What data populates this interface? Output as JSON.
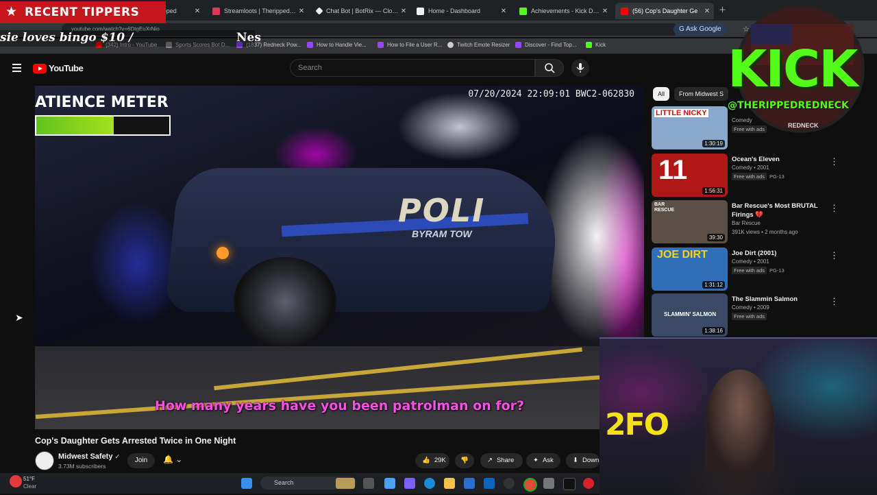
{
  "browser": {
    "tabs": [
      {
        "title": "Streamloots | Therippedred",
        "color": "#e3384f",
        "partial_title": "treamloots | Theripped"
      },
      {
        "title": "Streamloots | Therippedredn",
        "color": "#e3384f"
      },
      {
        "title": "Chat Bot | BotRix — Cloud S",
        "color": "#f0f0f0"
      },
      {
        "title": "Home - Dashboard",
        "color": "#f0f0f0"
      },
      {
        "title": "Achievements - Kick Dashbo",
        "color": "#53fc18"
      },
      {
        "title": "(56) Cop's Daughter Ge",
        "color": "#ff0000"
      }
    ],
    "url": "youtube.com/watch?v=6DtgEuXrNio",
    "ask_google": "Ask Google",
    "bookmarks": [
      {
        "label": "(342) Intro - YouTube",
        "color": "#ff0000"
      },
      {
        "label": "Sports Scores Bot D...",
        "color": "#888888"
      },
      {
        "label": "(1837) Redneck Pow...",
        "color": "#9146ff"
      },
      {
        "label": "How to Handle Vie...",
        "color": "#9146ff"
      },
      {
        "label": "How to File a User R...",
        "color": "#9146ff"
      },
      {
        "label": "Twitch Emote Resizer",
        "color": "#cccccc"
      },
      {
        "label": "Discover - Find Top...",
        "color": "#9146ff"
      },
      {
        "label": "Kick",
        "color": "#53fc18"
      }
    ]
  },
  "youtube": {
    "logo": "YouTube",
    "search_placeholder": "Search",
    "video": {
      "timestamp": "07/20/2024 22:09:01   BWC2-062830",
      "patience_title": "ATIENCE METER",
      "patience_level": 0.58,
      "car_text": "POLI",
      "car_subtext": "BYRAM TOW",
      "subtitle": "How many years have you been patrolman on for?",
      "title": "Cop's Daughter Gets Arrested Twice in One Night"
    },
    "channel": {
      "name": "Midwest Safety",
      "subs": "3.73M subscribers",
      "join": "Join"
    },
    "actions": {
      "likes": "29K",
      "share": "Share",
      "ask": "Ask",
      "download": "Down"
    },
    "chips": {
      "all": "All",
      "from": "From Midwest S"
    },
    "recommendations": [
      {
        "title": "",
        "meta1": "Comedy",
        "meta2": "Free with ads",
        "rating": "",
        "duration": "1:30:19",
        "thumb_color": "#8aa8cc",
        "thumb_text": "LITTLE NICKY"
      },
      {
        "title": "Ocean's Eleven",
        "meta1": "Comedy • 2001",
        "meta2": "Free with ads",
        "rating": "PG-13",
        "duration": "1:56:31",
        "thumb_color": "#b01818",
        "thumb_text": "11"
      },
      {
        "title": "Bar Rescue's Most BRUTAL Firings 💔",
        "meta1": "Bar Rescue",
        "meta2": "391K views • 2 months ago",
        "rating": "",
        "duration": "39:30",
        "thumb_color": "#5a5046",
        "thumb_text": "BAR RESCUE"
      },
      {
        "title": "Joe Dirt (2001)",
        "meta1": "Comedy • 2001",
        "meta2": "Free with ads",
        "rating": "PG-13",
        "duration": "1:31:12",
        "thumb_color": "#2f6fb8",
        "thumb_text": "JOE DIRT"
      },
      {
        "title": "The Slammin Salmon",
        "meta1": "Comedy • 2009",
        "meta2": "Free with ads",
        "rating": "",
        "duration": "1:38:16",
        "thumb_color": "#3a4a66",
        "thumb_text": "SLAMMIN' SALMON"
      }
    ]
  },
  "overlay": {
    "recent_tippers": "RECENT TIPPERS",
    "ticker_left": "sie loves bingo $10 /",
    "ticker_right": "Nes",
    "kick_word": "KICK",
    "kick_handle": "@THERIPPEDREDNECK",
    "kick_sub": "REDNECK",
    "cam_sign": "2FO"
  },
  "taskbar": {
    "weather_temp": "51°F",
    "weather_desc": "Clear",
    "search": "Search"
  }
}
